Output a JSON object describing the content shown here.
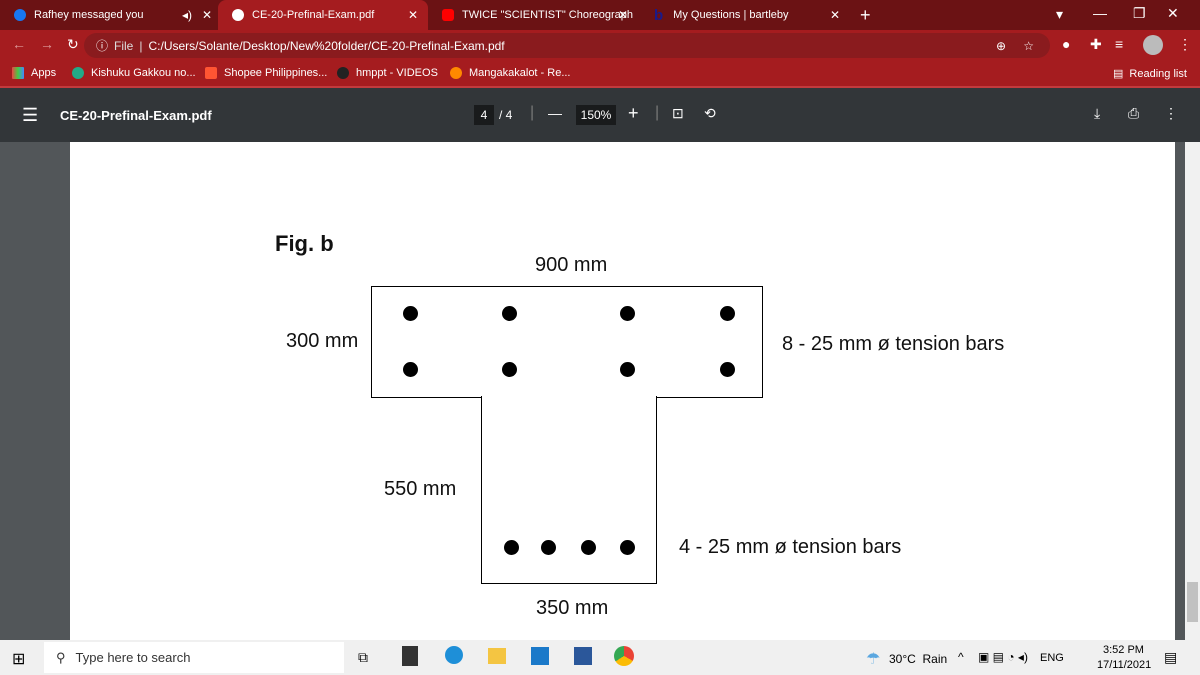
{
  "browser": {
    "tabs": [
      {
        "label": "Rafhey messaged you",
        "icon": "facebook-icon"
      },
      {
        "label": "CE-20-Prefinal-Exam.pdf",
        "icon": "globe-icon",
        "active": true
      },
      {
        "label": "TWICE \"SCIENTIST\" Choreograph",
        "icon": "youtube-icon"
      },
      {
        "label": "My Questions | bartleby",
        "icon": "bartleby-icon"
      }
    ],
    "url_prefix": "File",
    "url": "C:/Users/Solante/Desktop/New%20folder/CE-20-Prefinal-Exam.pdf",
    "bookmarks": [
      "Apps",
      "Kishuku Gakkou no...",
      "Shopee Philippines...",
      "hmppt - VIDEOS",
      "Mangakakalot - Re..."
    ],
    "reading_list": "Reading list",
    "accent": "#a51c1f"
  },
  "pdf": {
    "title": "CE-20-Prefinal-Exam.pdf",
    "page_current": "4",
    "page_total": "/ 4",
    "zoom": "150%"
  },
  "figure": {
    "title": "Fig. b",
    "flange_width": "900 mm",
    "flange_depth": "300 mm",
    "top_bars": "8 - 25 mm ø tension bars",
    "web_depth": "550 mm",
    "bottom_bars": "4 - 25 mm ø tension bars",
    "web_width": "350 mm"
  },
  "taskbar": {
    "search_placeholder": "Type here to search",
    "weather": "30°C  Rain",
    "language": "ENG",
    "time": "3:52 PM",
    "date": "17/11/2021"
  }
}
